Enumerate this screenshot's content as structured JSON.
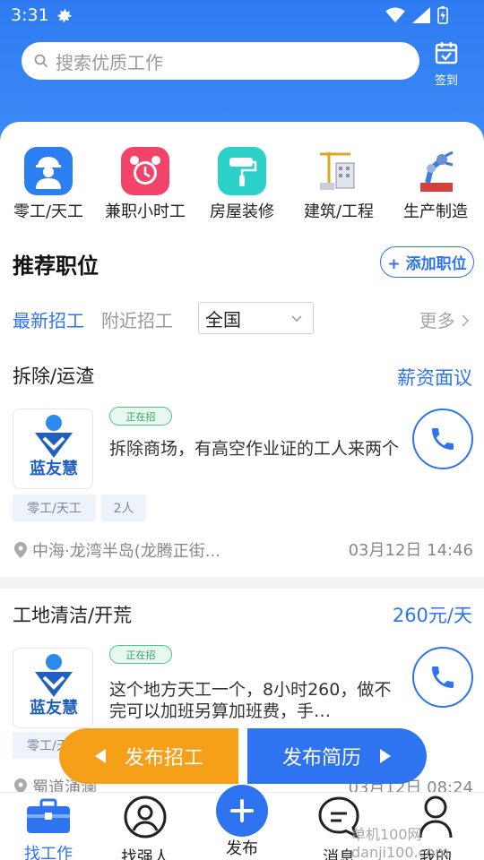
{
  "status_bar": {
    "time": "3:31"
  },
  "search": {
    "placeholder": "搜索优质工作"
  },
  "signin": {
    "label": "签到"
  },
  "categories": [
    {
      "label": "零工/天工",
      "icon": "worker-icon"
    },
    {
      "label": "兼职小时工",
      "icon": "alarm-clock-icon"
    },
    {
      "label": "房屋装修",
      "icon": "paint-roller-icon"
    },
    {
      "label": "建筑/工程",
      "icon": "construction-icon"
    },
    {
      "label": "生产制造",
      "icon": "robot-arm-icon"
    }
  ],
  "section": {
    "title": "推荐职位",
    "add_button": "+ 添加职位"
  },
  "filters": {
    "tab_latest": "最新招工",
    "tab_nearby": "附近招工",
    "region": "全国",
    "more": "更多"
  },
  "jobs": [
    {
      "title": "拆除/运渣",
      "pay": "薪资面议",
      "logo_text": "蓝友慧",
      "badge": "正在招",
      "description": "拆除商场，有高空作业证的工人来两个",
      "tags": [
        "零工/天工",
        "2人"
      ],
      "location": "中海·龙湾半岛(龙腾正街...",
      "date": "03月12日 14:46"
    },
    {
      "title": "工地清洁/开荒",
      "pay": "260元/天",
      "logo_text": "蓝友慧",
      "badge": "正在招",
      "description": "这个地方天工一个，8小时260，做不完可以加班另算加班费，手…",
      "tags": [
        "零工/天工"
      ],
      "location": "蜀道涌澜",
      "date": "03月12日 08:24"
    }
  ],
  "publish": {
    "left": "发布招工",
    "right": "发布简历"
  },
  "tabbar": {
    "find_job": "找工作",
    "find_worker": "找强人",
    "publish": "发布",
    "messages": "消息",
    "mine": "我的"
  },
  "watermark": "单机100网 danji100.com",
  "colors": {
    "primary": "#2e73f0",
    "orange": "#f6a019",
    "green_badge": "#2fa868"
  }
}
